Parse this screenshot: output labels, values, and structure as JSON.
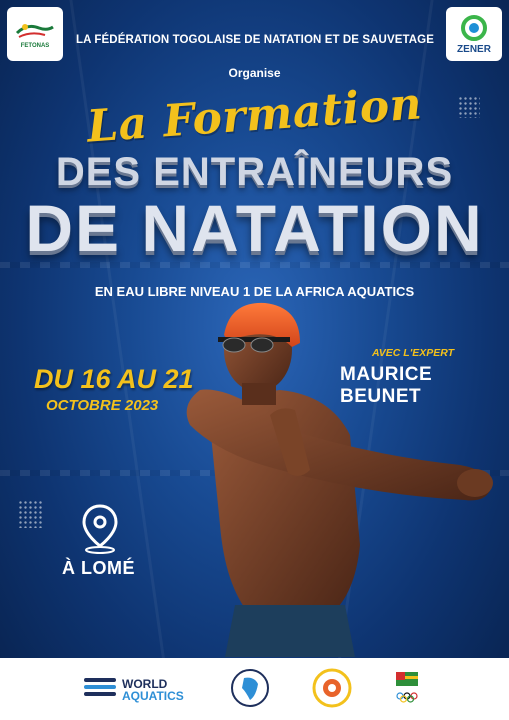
{
  "header": {
    "federation_name": "LA FÉDÉRATION TOGOLAISE DE NATATION ET DE SAUVETAGE",
    "organise": "Organise",
    "logo_left_text": "FETONAS",
    "logo_right_text": "ZENER"
  },
  "title": {
    "script_line": "La Formation",
    "line2": "DES ENTRAÎNEURS",
    "line3": "DE NATATION",
    "subtitle": "EN EAU LIBRE NIVEAU 1 DE LA AFRICA AQUATICS"
  },
  "event": {
    "date_main": "DU 16 AU 21",
    "date_sub": "OCTOBRE 2023",
    "expert_label": "AVEC L'EXPERT",
    "expert_name": "MAURICE BEUNET",
    "location": "À LOMÉ"
  },
  "footer": {
    "partner_1_line1": "WORLD",
    "partner_1_line2": "AQUATICS"
  },
  "colors": {
    "accent_yellow": "#f3c11c",
    "background_blue": "#184a92",
    "cap_orange": "#e8632a"
  },
  "icons": [
    "location-pin-icon",
    "fetonas-logo",
    "zener-logo",
    "world-aquatics-logo",
    "africa-aquatics-logo",
    "partner-seal-logo",
    "cnot-togo-logo"
  ]
}
